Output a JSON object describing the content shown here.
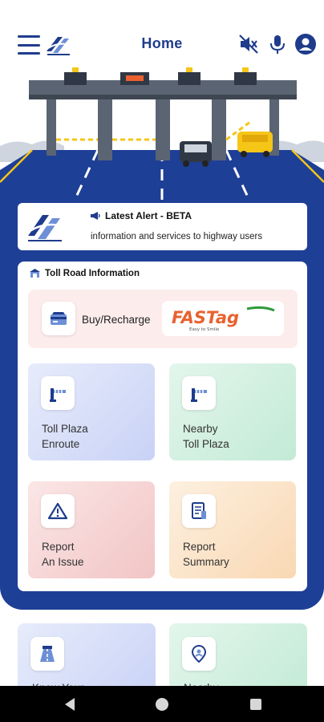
{
  "header": {
    "title": "Home",
    "menu_icon": "hamburger-menu-icon",
    "logo_icon": "highway-logo-icon",
    "mute_icon": "speaker-muted-icon",
    "mic_icon": "microphone-icon",
    "profile_icon": "user-account-icon"
  },
  "hero": {
    "illustration": "toll-plaza-illustration"
  },
  "alert": {
    "title": "Latest Alert - BETA",
    "text": "information and services to highway users",
    "icon": "megaphone-icon"
  },
  "toll_info": {
    "section_title": "Toll Road Information",
    "section_icon": "toll-booth-icon",
    "fastag": {
      "label": "Buy/Recharge",
      "icon": "fastag-card-icon",
      "logo_text": "FASTag",
      "logo_tagline": "Easy to Smile"
    },
    "tiles": [
      {
        "line1": "Toll Plaza",
        "line2": "Enroute",
        "icon": "toll-barrier-icon"
      },
      {
        "line1": "Nearby",
        "line2": "Toll Plaza",
        "icon": "toll-barrier-icon"
      },
      {
        "line1": "Report",
        "line2": "An Issue",
        "icon": "warning-triangle-icon"
      },
      {
        "line1": "Report",
        "line2": "Summary",
        "icon": "report-document-icon"
      }
    ]
  },
  "lower_tiles": [
    {
      "label": "Know Your...",
      "icon": "highway-road-icon"
    },
    {
      "label": "Nearby...",
      "icon": "location-person-icon"
    }
  ],
  "nav": {
    "back_icon": "back-triangle-icon",
    "home_icon": "home-circle-icon",
    "recents_icon": "recents-square-icon"
  },
  "colors": {
    "brand_blue": "#1e3f96",
    "header_blue": "#1f3c8c",
    "fastag_orange": "#e9612f"
  }
}
